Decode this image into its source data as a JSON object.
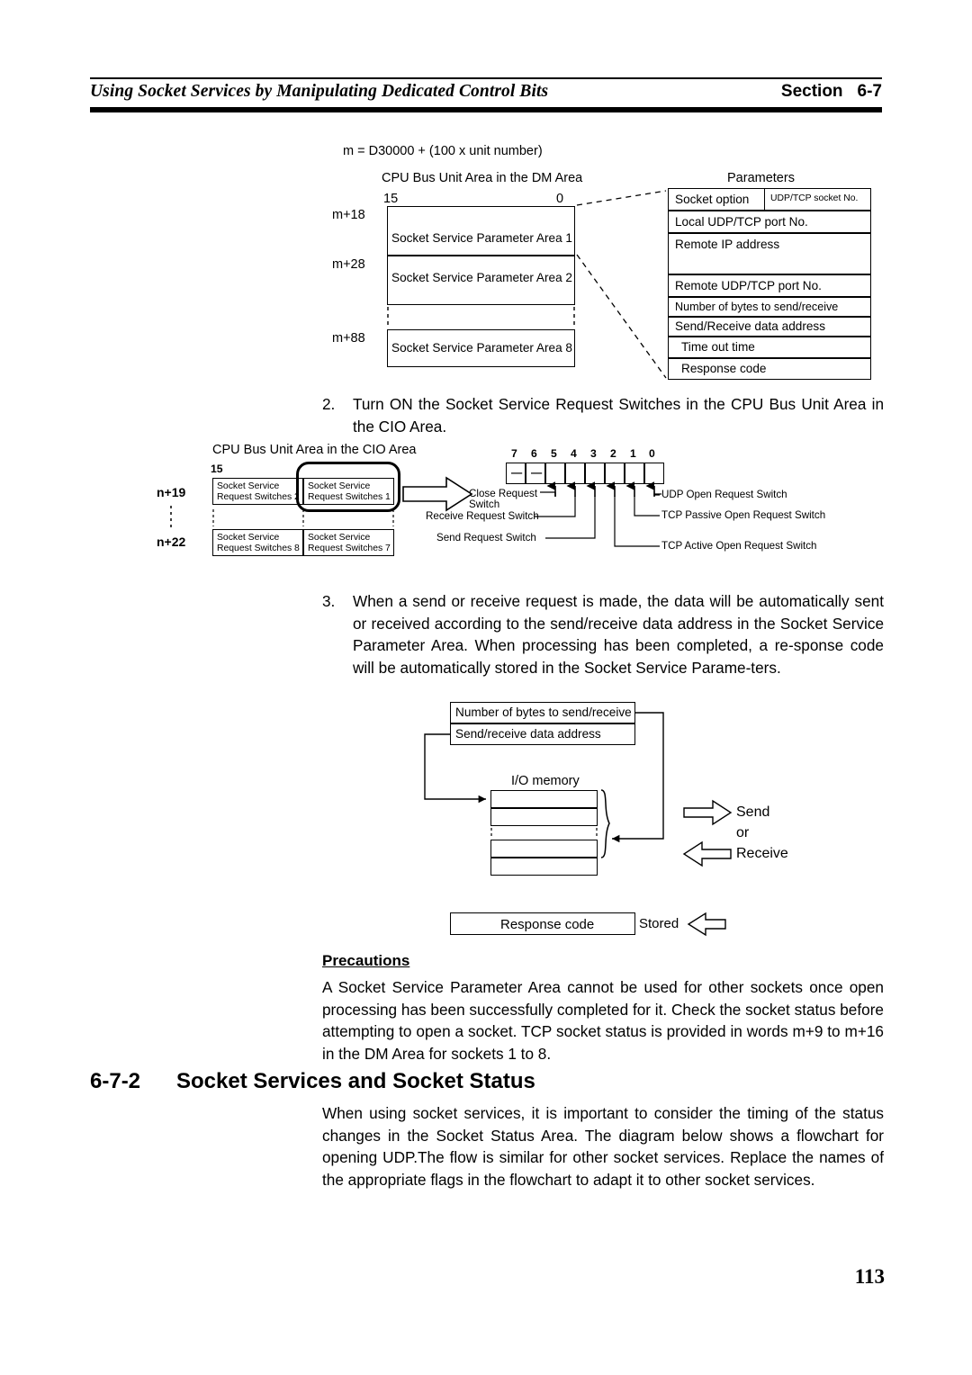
{
  "header": {
    "title": "Using Socket Services by Manipulating Dedicated Control Bits",
    "section_label": "Section",
    "section_number": "6-7"
  },
  "dm_diagram": {
    "formula": "m = D30000 + (100 x unit number)",
    "area_caption": "CPU Bus Unit Area in the DM Area",
    "bit_high": "15",
    "bit_low": "0",
    "addresses": [
      "m+18",
      "m+28",
      "m+88"
    ],
    "areas": [
      "Socket Service Parameter Area 1",
      "Socket Service Parameter Area 2",
      "Socket Service Parameter Area 8"
    ],
    "parameters_caption": "Parameters",
    "parameters": [
      "Socket option",
      "UDP/TCP socket No.",
      "Local UDP/TCP port No.",
      "Remote IP address",
      "Remote UDP/TCP port No.",
      "Number of bytes to send/receive",
      "Send/Receive data address",
      "Time out time",
      "Response code"
    ]
  },
  "step2": {
    "number": "2.",
    "text": "Turn ON the Socket Service Request Switches in the CPU Bus Unit Area in the CIO Area."
  },
  "cio_diagram": {
    "area_caption": "CPU Bus Unit Area in the CIO Area",
    "bit_high": "15",
    "addresses": [
      "n+19",
      "n+22"
    ],
    "cells": [
      "Socket Service\nRequest Switches 2",
      "Socket Service\nRequest Switches 1",
      "Socket Service\nRequest Switches 8",
      "Socket Service\nRequest Switches 7"
    ],
    "bit_numbers": [
      "7",
      "6",
      "5",
      "4",
      "3",
      "2",
      "1",
      "0"
    ],
    "bit_values": [
      "—",
      "—",
      "",
      "",
      "",
      "",
      "",
      ""
    ],
    "left_callouts": [
      "Close Request\nSwitch",
      "Receive Request Switch",
      "Send Request Switch"
    ],
    "right_callouts": [
      "UDP Open Request Switch",
      "TCP Passive Open Request Switch",
      "TCP Active Open Request Switch"
    ]
  },
  "step3": {
    "number": "3.",
    "text": "When a send or receive request is made, the data will be automatically sent or received according to the send/receive data address in the Socket Service Parameter Area. When processing has been completed, a re-sponse code will be automatically stored in the Socket Service Parame-ters."
  },
  "io_diagram": {
    "bytes_label": "Number of bytes to send/receive",
    "address_label": "Send/receive data address",
    "memory_label": "I/O memory",
    "send_label": "Send",
    "or_label": "or",
    "receive_label": "Receive",
    "response_label": "Response code",
    "stored_label": "Stored"
  },
  "precautions": {
    "title": "Precautions",
    "text": "A Socket Service Parameter Area cannot be used for other sockets once open processing has been successfully completed for it. Check the socket status before attempting to open a socket. TCP socket status is provided in words m+9 to m+16 in the DM Area for sockets 1 to 8."
  },
  "section_6_7_2": {
    "number": "6-7-2",
    "title": "Socket Services and Socket Status",
    "body": "When using socket services, it is important to consider the timing of the status changes in the Socket Status Area. The diagram below shows a flowchart for opening UDP.The flow is similar for other socket services. Replace the names of the appropriate flags in the flowchart to adapt it to other socket services."
  },
  "page_number": "113"
}
